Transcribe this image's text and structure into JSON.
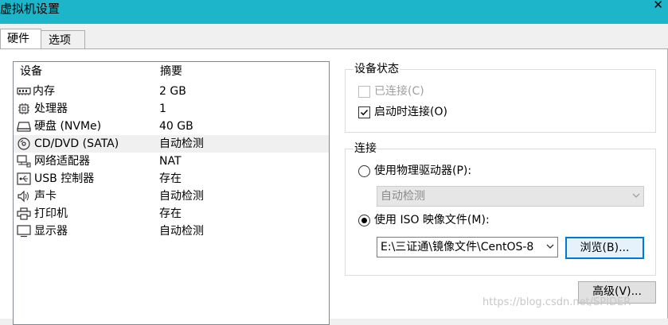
{
  "window": {
    "title": "虚拟机设置",
    "close_glyph": "✕"
  },
  "tabs": [
    {
      "label": "硬件"
    },
    {
      "label": "选项"
    }
  ],
  "device_list": {
    "col_device": "设备",
    "col_summary": "摘要",
    "items": [
      {
        "name": "内存",
        "summary": "2 GB",
        "icon": "memory-icon"
      },
      {
        "name": "处理器",
        "summary": "1",
        "icon": "cpu-icon"
      },
      {
        "name": "硬盘 (NVMe)",
        "summary": "40 GB",
        "icon": "hard-disk-icon"
      },
      {
        "name": "CD/DVD (SATA)",
        "summary": "自动检测",
        "icon": "cd-dvd-icon",
        "selected": true
      },
      {
        "name": "网络适配器",
        "summary": "NAT",
        "icon": "network-adapter-icon"
      },
      {
        "name": "USB 控制器",
        "summary": "存在",
        "icon": "usb-icon"
      },
      {
        "name": "声卡",
        "summary": "自动检测",
        "icon": "speaker-icon"
      },
      {
        "name": "打印机",
        "summary": "存在",
        "icon": "printer-icon"
      },
      {
        "name": "显示器",
        "summary": "自动检测",
        "icon": "monitor-icon"
      }
    ]
  },
  "device_status": {
    "title": "设备状态",
    "connected_label": "已连接(C)",
    "connected_checked": false,
    "connect_on_startup_label": "启动时连接(O)",
    "connect_on_startup_checked": true
  },
  "connection": {
    "title": "连接",
    "physical_drive_label": "使用物理驱动器(P):",
    "physical_drive_value": "自动检测",
    "iso_label": "使用 ISO 映像文件(M):",
    "iso_path": "E:\\三证通\\镜像文件\\CentOS-8",
    "browse_label": "浏览(B)...",
    "selected_option": "iso"
  },
  "advanced_label": "高级(V)...",
  "watermark": "https://blog.csdn.net/SPIDER"
}
